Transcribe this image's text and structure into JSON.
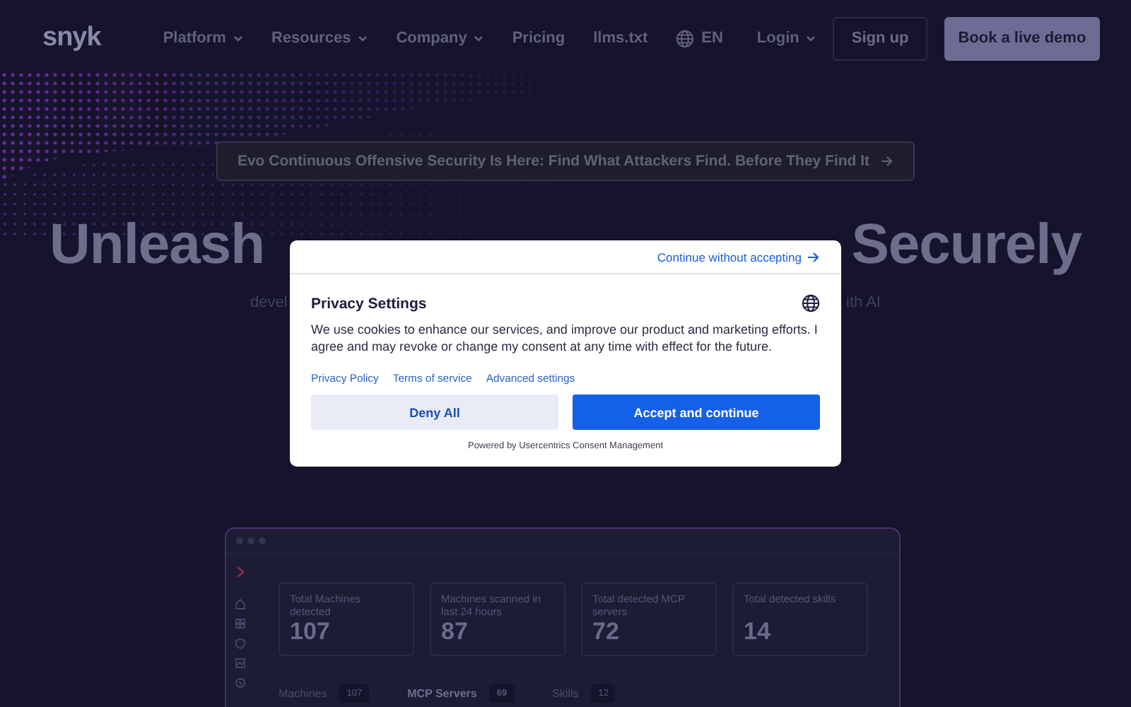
{
  "header": {
    "logo": "snyk",
    "nav": [
      {
        "label": "Platform",
        "kind": "dropdown"
      },
      {
        "label": "Resources",
        "kind": "dropdown"
      },
      {
        "label": "Company",
        "kind": "dropdown"
      },
      {
        "label": "Pricing",
        "kind": "link"
      },
      {
        "label": "llms.txt",
        "kind": "link"
      }
    ],
    "language": "EN",
    "login": "Login",
    "signup": "Sign up",
    "demo": "Book a live demo"
  },
  "hero": {
    "announcement": "Evo Continuous Offensive Security Is Here: Find What Attackers Find. Before They Find It",
    "headline_left": "Unleash",
    "headline_right": "Securely",
    "subtitle_left": "devel",
    "subtitle_right": "ith AI"
  },
  "dashboard": {
    "stats": [
      {
        "label": "Total Machines detected",
        "value": "107"
      },
      {
        "label": "Machines scanned in last 24 hours",
        "value": "87"
      },
      {
        "label": "Total detected MCP servers",
        "value": "72"
      },
      {
        "label": "Total detected skills",
        "value": "14"
      }
    ],
    "tabs": [
      {
        "label": "Machines",
        "count": "107",
        "selected": false
      },
      {
        "label": "MCP Servers",
        "count": "69",
        "selected": true
      },
      {
        "label": "Skills",
        "count": "12",
        "selected": false
      }
    ]
  },
  "consent": {
    "continue": "Continue without accepting",
    "title": "Privacy Settings",
    "body": "We use cookies to enhance our services, and improve our product and marketing efforts. I agree and may revoke or change my consent at any time with effect for the future.",
    "links": [
      "Privacy Policy",
      "Terms of service",
      "Advanced settings"
    ],
    "deny": "Deny All",
    "accept": "Accept and continue",
    "powered": "Powered by Usercentrics Consent Management"
  }
}
